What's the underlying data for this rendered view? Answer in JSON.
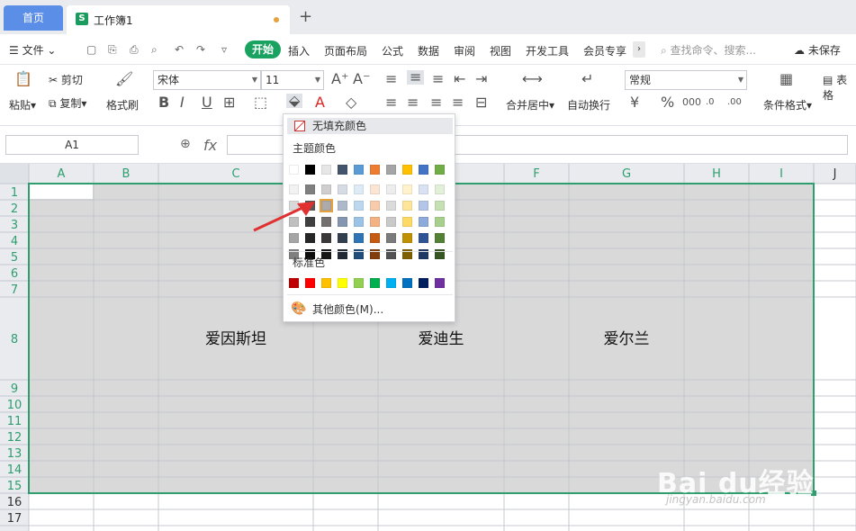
{
  "tabs": {
    "home": "首页",
    "doc": "工作簿1"
  },
  "menu": {
    "file": "文件",
    "items": [
      "开始",
      "插入",
      "页面布局",
      "公式",
      "数据",
      "审阅",
      "视图",
      "开发工具",
      "会员专享"
    ],
    "search_placeholder": "查找命令、搜索...",
    "unsaved": "未保存"
  },
  "ribbon": {
    "paste": "粘贴",
    "cut": "剪切",
    "copy": "复制",
    "format_painter": "格式刷",
    "font_name": "宋体",
    "font_size": "11",
    "merge_center": "合并居中",
    "wrap_text": "自动换行",
    "number_format": "常规",
    "cond_format": "条件格式",
    "table_style": "表格"
  },
  "formula_bar": {
    "name_box": "A1",
    "fx": "fx",
    "value": ""
  },
  "sheet": {
    "columns": [
      "A",
      "B",
      "C",
      "D",
      "E",
      "F",
      "G",
      "H",
      "I",
      "J"
    ],
    "rows": [
      "1",
      "2",
      "3",
      "4",
      "5",
      "6",
      "7",
      "8",
      "9",
      "10",
      "11",
      "12",
      "13",
      "14",
      "15",
      "16",
      "17"
    ],
    "cells": [
      {
        "ref": "C8",
        "text": "爱因斯坦"
      },
      {
        "ref": "E8",
        "text": "爱迪生"
      },
      {
        "ref": "G8",
        "text": "爱尔兰"
      }
    ]
  },
  "fill_menu": {
    "no_fill": "无填充颜色",
    "theme_label": "主题颜色",
    "standard_label": "标准色",
    "more_colors": "其他颜色(M)...",
    "theme_top": [
      "#ffffff",
      "#000000",
      "#e7e6e6",
      "#44546a",
      "#5b9bd5",
      "#ed7d31",
      "#a5a5a5",
      "#ffc000",
      "#4472c4",
      "#70ad47"
    ],
    "theme_shades": [
      [
        "#f2f2f2",
        "#7f7f7f",
        "#d0cece",
        "#d6dce4",
        "#deebf6",
        "#fbe5d5",
        "#ededed",
        "#fff2cc",
        "#d9e2f3",
        "#e2efd9"
      ],
      [
        "#d8d8d8",
        "#595959",
        "#aeaaaa",
        "#adb9ca",
        "#bdd7ee",
        "#f7cbac",
        "#dbdbdb",
        "#fee599",
        "#b4c6e7",
        "#c5e0b3"
      ],
      [
        "#bfbfbf",
        "#3f3f3f",
        "#757070",
        "#8496b0",
        "#9cc3e5",
        "#f4b183",
        "#c9c9c9",
        "#ffd965",
        "#8eaadb",
        "#a8d08d"
      ],
      [
        "#a5a5a5",
        "#262626",
        "#3a3838",
        "#323f4f",
        "#2e75b5",
        "#c55a11",
        "#7b7b7b",
        "#bf9000",
        "#2f5496",
        "#538135"
      ],
      [
        "#7f7f7f",
        "#0c0c0c",
        "#171616",
        "#222a35",
        "#1e4e79",
        "#833c0b",
        "#525252",
        "#7f6000",
        "#1f3864",
        "#375623"
      ]
    ],
    "standard": [
      "#c00000",
      "#ff0000",
      "#ffc000",
      "#ffff00",
      "#92d050",
      "#00b050",
      "#00b0f0",
      "#0070c0",
      "#002060",
      "#7030a0"
    ]
  },
  "watermark": {
    "brand": "Bai du经验",
    "url": "jingyan.baidu.com"
  },
  "colors": {
    "accent": "#1aa260",
    "selection": "#2e9e6f",
    "fill_gray": "#d9d9d9"
  }
}
